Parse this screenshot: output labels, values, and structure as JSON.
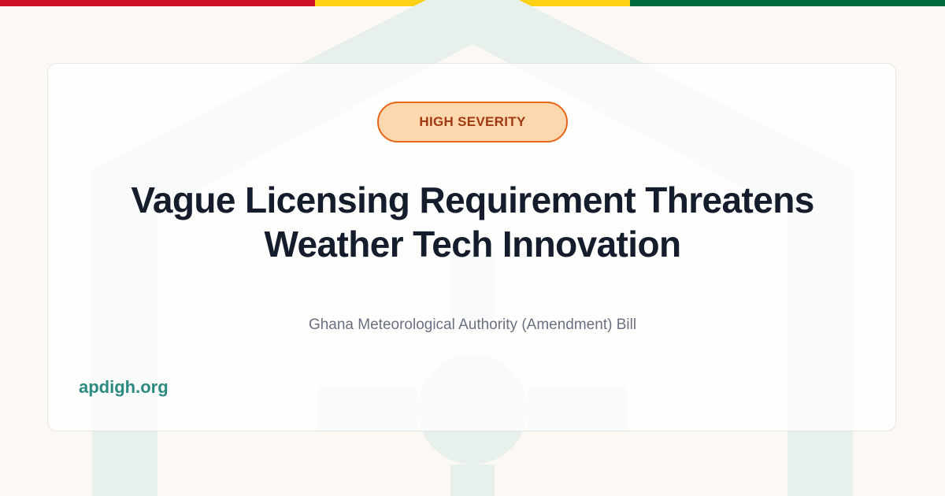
{
  "flag_colors": [
    "#ce1126",
    "#fcd116",
    "#006b3f"
  ],
  "watermark_color": "#e8f0ec",
  "badge": {
    "label": "HIGH SEVERITY"
  },
  "headline": "Vague Licensing Requirement Threatens Weather Tech Innovation",
  "subtitle": "Ghana Meteorological Authority (Amendment) Bill",
  "site": "apdigh.org"
}
